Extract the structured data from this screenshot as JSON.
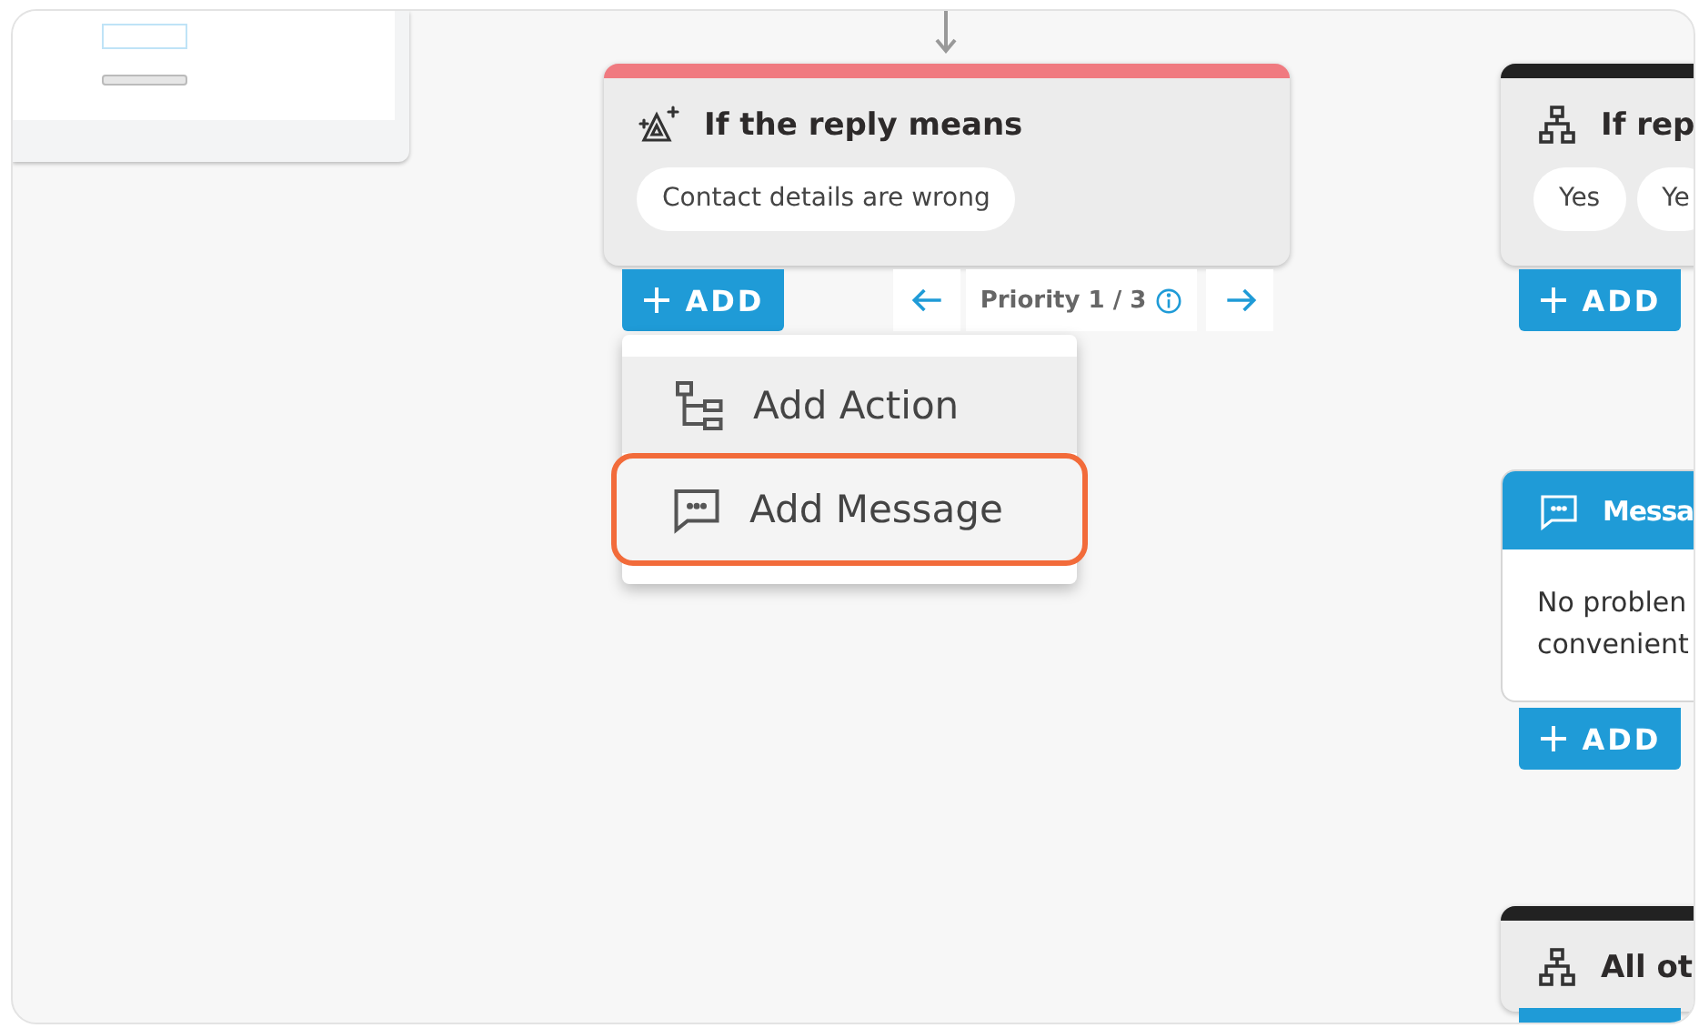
{
  "nodes": [
    {
      "kind": "reply_meaning",
      "title": "If the reply means",
      "chips": [
        "Contact details are wrong"
      ],
      "add_button": "ADD",
      "priority": "Priority 1 / 3",
      "menu": [
        {
          "kind": "action",
          "label": "Add Action",
          "hovered": true,
          "selected": false
        },
        {
          "kind": "message",
          "label": "Add Message",
          "hovered": false,
          "selected": true
        }
      ]
    },
    {
      "kind": "branch",
      "title": "If rep",
      "chips": [
        "Yes",
        "Ye"
      ],
      "add_button": "ADD"
    },
    {
      "kind": "message",
      "title": "Messa",
      "body": [
        "No problen",
        "convenient"
      ],
      "add_button": "ADD"
    },
    {
      "kind": "branch",
      "title": "All ot",
      "add_button_cut_off": true
    }
  ]
}
